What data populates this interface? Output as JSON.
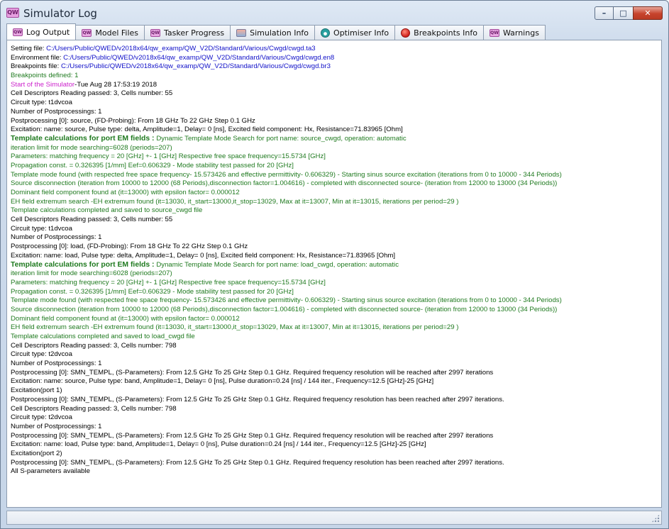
{
  "window": {
    "title": "Simulator Log",
    "app_icon_text": "QW",
    "min_glyph": "–",
    "max_glyph": "□",
    "close_glyph": "✕"
  },
  "tabs": [
    {
      "label": "Log Output",
      "icon": "qw-icon",
      "active": true
    },
    {
      "label": "Model Files",
      "icon": "qw-icon"
    },
    {
      "label": "Tasker Progress",
      "icon": "qw-icon"
    },
    {
      "label": "Simulation Info",
      "icon": "info-icon"
    },
    {
      "label": "Optimiser Info",
      "icon": "optimiser-icon"
    },
    {
      "label": "Breakpoints Info",
      "icon": "breakpoint-icon"
    },
    {
      "label": "Warnings",
      "icon": "qw-icon"
    }
  ],
  "colors": {
    "default": "#000000",
    "path": "#1010c8",
    "template": "#1f7a1f",
    "start": "#cc22cc"
  },
  "log": [
    [
      {
        "t": "Setting file: "
      },
      {
        "t": "C:/Users/Public/QWED/v2018x64/qw_examp/QW_V2D/Standard/Various/Cwgd/cwgd.ta3",
        "c": "blue"
      }
    ],
    [
      {
        "t": "Environment file: "
      },
      {
        "t": "C:/Users/Public/QWED/v2018x64/qw_examp/QW_V2D/Standard/Various/Cwgd/cwgd.en8",
        "c": "blue"
      }
    ],
    [
      {
        "t": "Breakpoints file: "
      },
      {
        "t": "C:/Users/Public/QWED/v2018x64/qw_examp/QW_V2D/Standard/Various/Cwgd/cwgd.br3",
        "c": "blue"
      }
    ],
    [
      {
        "t": "Breakpoints defined: 1",
        "c": "green"
      }
    ],
    [
      {
        "t": "Start of the Simulator",
        "c": "magenta"
      },
      {
        "t": "-Tue Aug 28 17:53:19 2018"
      }
    ],
    [
      {
        "t": "Cell Descriptors Reading passed: 3, Cells number: 55"
      }
    ],
    [
      {
        "t": "Circuit type: t1dvcoa"
      }
    ],
    [
      {
        "t": "Number of Postprocessings: 1"
      }
    ],
    [
      {
        "t": "Postprocessing [0]: source, (FD-Probing): From 18 GHz To 22 GHz Step 0.1 GHz"
      }
    ],
    [
      {
        "t": "Excitation: name: source, Pulse type: delta, Amplitude=1, Delay= 0 [ns], Excited field component: Hx, Resistance=71.83965 [Ohm]"
      }
    ],
    [
      {
        "t": "Template calculations for port EM fields : ",
        "c": "green",
        "b": true
      },
      {
        "t": "Dynamic Template Mode Search for port name: source_cwgd, operation: automatic",
        "c": "green"
      }
    ],
    [
      {
        "t": "iteration limit for mode searching=6028 (periods=207)",
        "c": "green"
      }
    ],
    [
      {
        "t": "Parameters: matching frequency = 20 [GHz] +- 1 [GHz] Respective free space frequency=15.5734 [GHz]",
        "c": "green"
      }
    ],
    [
      {
        "t": "Propagation const. = 0.326395 [1/mm] Eef=0.606329 - Mode stability test passed for 20 [GHz]",
        "c": "green"
      }
    ],
    [
      {
        "t": "Template mode found (with respected free space frequency- 15.573426 and effective permittivity- 0.606329) - Starting sinus source excitation (iterations from 0 to 10000 - 344 Periods)",
        "c": "green"
      }
    ],
    [
      {
        "t": "Source disconnection (iteration from 10000 to 12000 (68 Periods),disconnection factor=1.004616) - completed with disconnected source- (iteration from 12000 to 13000 (34 Periods))",
        "c": "green"
      }
    ],
    [
      {
        "t": "Dominant field component found at (it=13000) with epsilon factor= 0.000012",
        "c": "green"
      }
    ],
    [
      {
        "t": "EH field extremum search -EH extremum found (it=13030, it_start=13000,it_stop=13029, Max at it=13007, Min at it=13015, iterations per period=29 )",
        "c": "green"
      }
    ],
    [
      {
        "t": "Template calculations completed and saved to source_cwgd file",
        "c": "green"
      }
    ],
    [
      {
        "t": "Cell Descriptors Reading passed: 3, Cells number: 55"
      }
    ],
    [
      {
        "t": "Circuit type: t1dvcoa"
      }
    ],
    [
      {
        "t": "Number of Postprocessings: 1"
      }
    ],
    [
      {
        "t": "Postprocessing [0]: load, (FD-Probing): From 18 GHz To 22 GHz Step 0.1 GHz"
      }
    ],
    [
      {
        "t": "Excitation: name: load, Pulse type: delta, Amplitude=1, Delay= 0 [ns], Excited field component: Hx, Resistance=71.83965 [Ohm]"
      }
    ],
    [
      {
        "t": "Template calculations for port EM fields : ",
        "c": "green",
        "b": true
      },
      {
        "t": "Dynamic Template Mode Search for port name: load_cwgd, operation: automatic",
        "c": "green"
      }
    ],
    [
      {
        "t": "iteration limit for mode searching=6028 (periods=207)",
        "c": "green"
      }
    ],
    [
      {
        "t": "Parameters: matching frequency = 20 [GHz] +- 1 [GHz] Respective free space frequency=15.5734 [GHz]",
        "c": "green"
      }
    ],
    [
      {
        "t": "Propagation const. = 0.326395 [1/mm] Eef=0.606329 - Mode stability test passed for 20 [GHz]",
        "c": "green"
      }
    ],
    [
      {
        "t": "Template mode found (with respected free space frequency- 15.573426 and effective permittivity- 0.606329) - Starting sinus source excitation (iterations from 0 to 10000 - 344 Periods)",
        "c": "green"
      }
    ],
    [
      {
        "t": "Source disconnection (iteration from 10000 to 12000 (68 Periods),disconnection factor=1.004616) - completed with disconnected source- (iteration from 12000 to 13000 (34 Periods))",
        "c": "green"
      }
    ],
    [
      {
        "t": "Dominant field component found at (it=13000) with epsilon factor= 0.000012",
        "c": "green"
      }
    ],
    [
      {
        "t": "EH field extremum search -EH extremum found (it=13030, it_start=13000,it_stop=13029, Max at it=13007, Min at it=13015, iterations per period=29 )",
        "c": "green"
      }
    ],
    [
      {
        "t": "Template calculations completed and saved to load_cwgd file",
        "c": "green"
      }
    ],
    [
      {
        "t": "Cell Descriptors Reading passed: 3, Cells number: 798"
      }
    ],
    [
      {
        "t": "Circuit type: t2dvcoa"
      }
    ],
    [
      {
        "t": "Number of Postprocessings: 1"
      }
    ],
    [
      {
        "t": "Postprocessing [0]: SMN_TEMPL, (S-Parameters): From 12.5 GHz To 25 GHz Step 0.1 GHz. Required frequency resolution will be reached after 2997 iterations"
      }
    ],
    [
      {
        "t": "Excitation: name: source, Pulse type: band, Amplitude=1, Delay= 0 [ns], Pulse duration=0.24 [ns] / 144 iter., Frequency=12.5 [GHz]-25 [GHz]"
      }
    ],
    [
      {
        "t": "Excitation(port 1)"
      }
    ],
    [
      {
        "t": "Postprocessing [0]: SMN_TEMPL, (S-Parameters): From 12.5 GHz To 25 GHz Step 0.1 GHz. Required frequency resolution has been reached after 2997 iterations."
      }
    ],
    [
      {
        "t": "Cell Descriptors Reading passed: 3, Cells number: 798"
      }
    ],
    [
      {
        "t": "Circuit type: t2dvcoa"
      }
    ],
    [
      {
        "t": "Number of Postprocessings: 1"
      }
    ],
    [
      {
        "t": "Postprocessing [0]: SMN_TEMPL, (S-Parameters): From 12.5 GHz To 25 GHz Step 0.1 GHz. Required frequency resolution will be reached after 2997 iterations"
      }
    ],
    [
      {
        "t": "Excitation: name: load, Pulse type: band, Amplitude=1, Delay= 0 [ns], Pulse duration=0.24 [ns] / 144 iter., Frequency=12.5 [GHz]-25 [GHz]"
      }
    ],
    [
      {
        "t": "Excitation(port 2)"
      }
    ],
    [
      {
        "t": "Postprocessing [0]: SMN_TEMPL, (S-Parameters): From 12.5 GHz To 25 GHz Step 0.1 GHz. Required frequency resolution has been reached after 2997 iterations."
      }
    ],
    [
      {
        "t": "All S-parameters available"
      }
    ]
  ]
}
